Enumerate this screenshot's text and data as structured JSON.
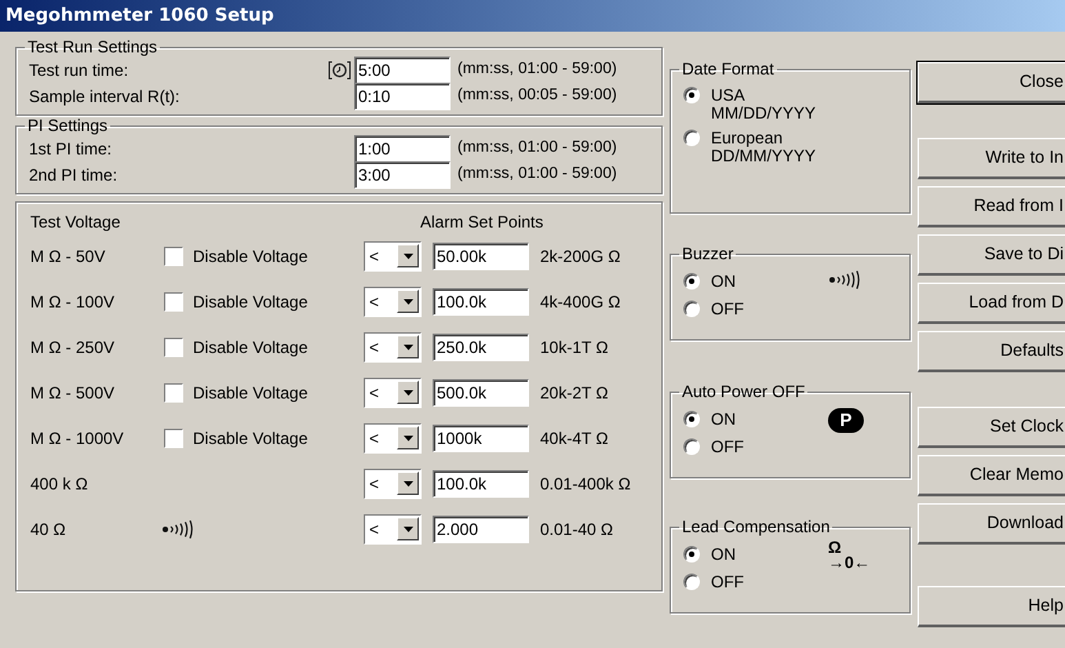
{
  "window": {
    "title": "Megohmmeter 1060 Setup"
  },
  "test_run": {
    "legend": "Test Run Settings",
    "rows": [
      {
        "kind": "timed",
        "label": "Test run time:",
        "value": "5:00",
        "hint": "(mm:ss, 01:00 - 59:00)"
      },
      {
        "label": "Sample interval R(t):",
        "value": "0:10",
        "hint": "(mm:ss, 00:05 - 59:00)"
      }
    ]
  },
  "pi_settings": {
    "legend": "PI Settings",
    "rows": [
      {
        "label": "1st PI time:",
        "value": "1:00",
        "hint": "(mm:ss, 01:00 - 59:00)"
      },
      {
        "label": "2nd PI time:",
        "value": "3:00",
        "hint": "(mm:ss, 01:00 - 59:00)"
      }
    ]
  },
  "test_voltage": {
    "heading": "Test Voltage",
    "alarm_heading": "Alarm Set Points",
    "rows": [
      {
        "kind": "voltage",
        "label": "M Ω - 50V",
        "disable_label": "Disable Voltage",
        "checked": false,
        "operator": "<",
        "value": "50.00k",
        "range": "2k-200G Ω"
      },
      {
        "kind": "voltage",
        "label": "M Ω - 100V",
        "disable_label": "Disable Voltage",
        "checked": false,
        "operator": "<",
        "value": "100.0k",
        "range": "4k-400G Ω"
      },
      {
        "kind": "voltage",
        "label": "M Ω - 250V",
        "disable_label": "Disable Voltage",
        "checked": false,
        "operator": "<",
        "value": "250.0k",
        "range": "10k-1T Ω"
      },
      {
        "kind": "voltage",
        "label": "M Ω - 500V",
        "disable_label": "Disable Voltage",
        "checked": false,
        "operator": "<",
        "value": "500.0k",
        "range": "20k-2T Ω"
      },
      {
        "kind": "voltage",
        "label": "M Ω - 1000V",
        "disable_label": "Disable Voltage",
        "checked": false,
        "operator": "<",
        "value": "1000k",
        "range": "40k-4T Ω"
      },
      {
        "kind": "plain",
        "label": "400 k Ω",
        "operator": "<",
        "value": "100.0k",
        "range": "0.01-400k Ω"
      },
      {
        "kind": "buzzer",
        "label": "40 Ω",
        "operator": "<",
        "value": "2.000",
        "range": "0.01-40 Ω"
      }
    ]
  },
  "date_format": {
    "legend": "Date Format",
    "options": [
      {
        "label": "USA",
        "sublabel": "MM/DD/YYYY",
        "selected": true
      },
      {
        "label": "European",
        "sublabel": "DD/MM/YYYY",
        "selected": false
      }
    ]
  },
  "buzzer": {
    "legend": "Buzzer",
    "kind": "buzzer",
    "options": [
      {
        "label": "ON",
        "selected": true
      },
      {
        "label": "OFF",
        "selected": false
      }
    ]
  },
  "auto_power_off": {
    "legend": "Auto Power OFF",
    "kind": "power",
    "icon_text": "P",
    "options": [
      {
        "label": "ON",
        "selected": true
      },
      {
        "label": "OFF",
        "selected": false
      }
    ]
  },
  "lead_compensation": {
    "legend": "Lead Compensation",
    "kind": "lead",
    "icon_lines": [
      "Ω",
      "→0←"
    ],
    "options": [
      {
        "label": "ON",
        "selected": true
      },
      {
        "label": "OFF",
        "selected": false
      }
    ]
  },
  "button_groups": [
    [
      {
        "label": "Close",
        "default": true
      }
    ],
    [
      {
        "label": "Write to In",
        "default": false
      },
      {
        "label": "Read from I",
        "default": false
      },
      {
        "label": "Save to Di",
        "default": false
      },
      {
        "label": "Load from D",
        "default": false
      },
      {
        "label": "Defaults",
        "default": false
      }
    ],
    [
      {
        "label": "Set Clock",
        "default": false
      },
      {
        "label": "Clear Memo",
        "default": false
      },
      {
        "label": "Download",
        "default": false
      }
    ],
    [
      {
        "label": "Help",
        "default": false
      }
    ]
  ]
}
